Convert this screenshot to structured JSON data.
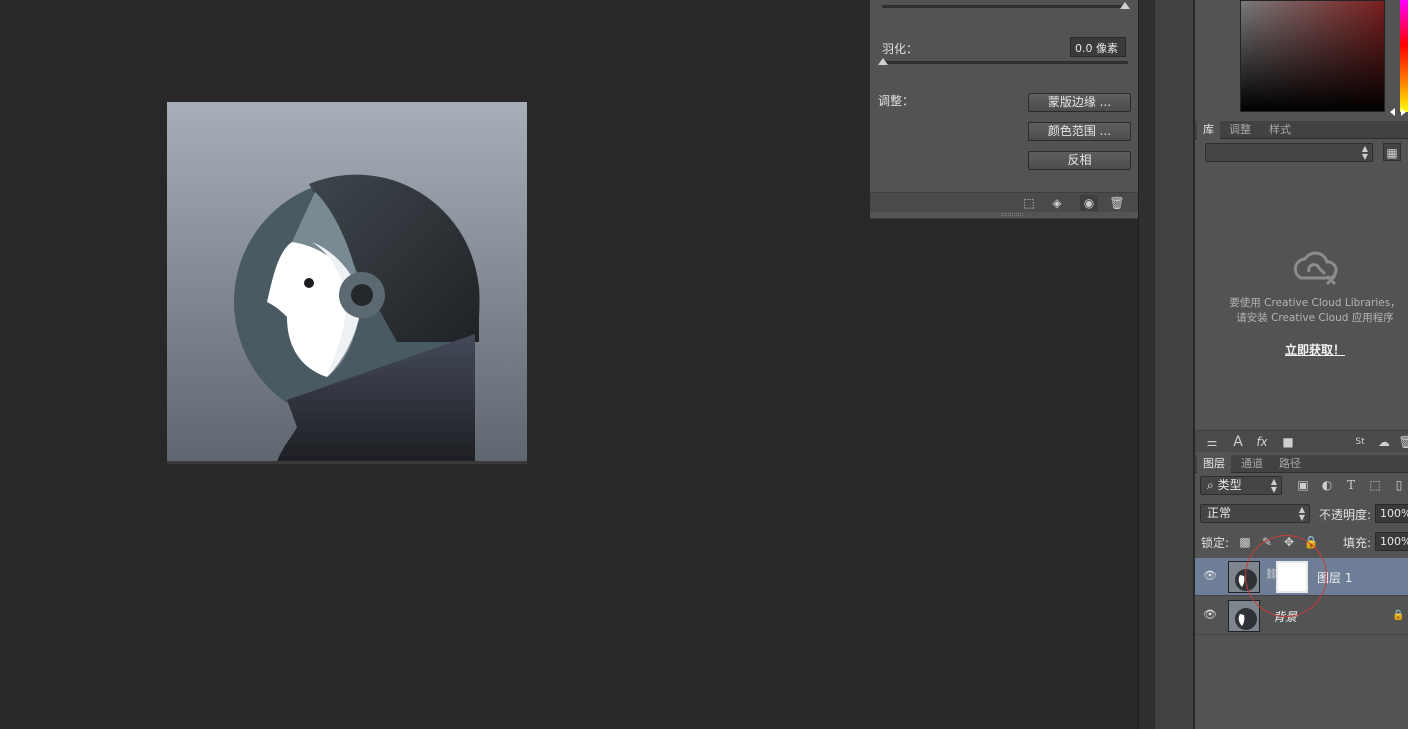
{
  "properties_panel": {
    "feather_label": "羽化：",
    "feather_value": "0.0 像素",
    "adjust_label": "调整：",
    "buttons": {
      "mask_edge": "蒙版边缘 ...",
      "color_range": "颜色范围 ...",
      "invert": "反相"
    },
    "footer_icons": [
      "selection-icon",
      "apply-mask-icon",
      "visibility-icon",
      "trash-icon"
    ]
  },
  "library_panel": {
    "tabs": [
      "库",
      "调整",
      "样式"
    ],
    "active_tab": "库",
    "message_line1": "要使用 Creative Cloud Libraries，",
    "message_line2": "请安装 Creative Cloud 应用程序",
    "link": "立即获取！",
    "toolbar_icons": [
      "character-style-icon",
      "text-icon",
      "fx-icon",
      "color-swatch-icon",
      "stock-icon",
      "cc-sync-icon",
      "trash-icon"
    ]
  },
  "layers_panel": {
    "tabs": [
      "图层",
      "通道",
      "路径"
    ],
    "active_tab": "图层",
    "filter": {
      "kind": "类型",
      "icons": [
        "image-filter-icon",
        "adjustment-filter-icon",
        "type-filter-icon",
        "shape-filter-icon",
        "smart-object-filter-icon"
      ]
    },
    "blend_mode": "正常",
    "opacity_label": "不透明度:",
    "opacity_value": "100%",
    "lock_label": "锁定:",
    "fill_label": "填充:",
    "fill_value": "100%",
    "layers": [
      {
        "name": "图层 1",
        "selected": true,
        "has_mask": true
      },
      {
        "name": "背景",
        "selected": false,
        "locked": true
      }
    ]
  },
  "colors": {
    "app_bg": "#282828",
    "panel_bg": "#535353",
    "selected_row": "#6e7e96",
    "annotation_circle": "#c73b3b"
  }
}
